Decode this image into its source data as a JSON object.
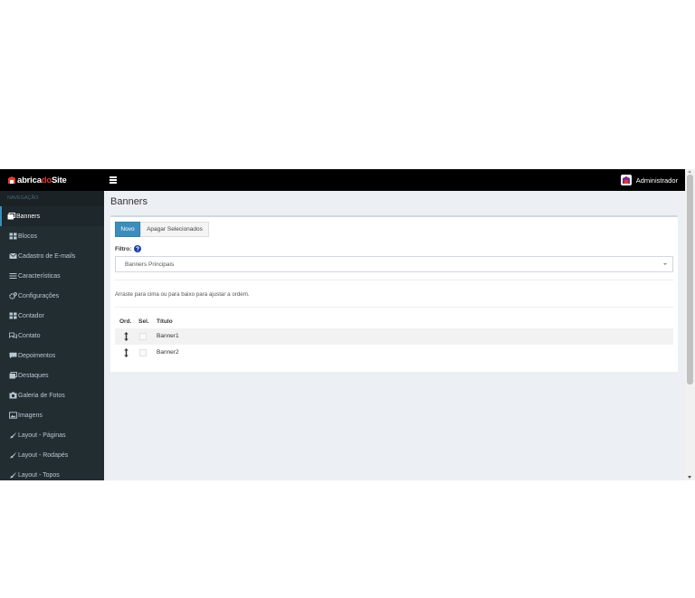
{
  "brand": {
    "part1": "abrica",
    "part2": "do",
    "part3": "Site"
  },
  "header": {
    "user_name": "Administrador"
  },
  "sidebar": {
    "header": "NAVEGAÇÃO",
    "items": [
      {
        "label": "Banners",
        "icon": "images-icon"
      },
      {
        "label": "Blocos",
        "icon": "th-large-icon"
      },
      {
        "label": "Cadastro de E-mails",
        "icon": "envelope-icon"
      },
      {
        "label": "Características",
        "icon": "list-icon"
      },
      {
        "label": "Configurações",
        "icon": "cogs-icon"
      },
      {
        "label": "Contador",
        "icon": "th-large-icon"
      },
      {
        "label": "Contato",
        "icon": "comments-icon"
      },
      {
        "label": "Depoimentos",
        "icon": "comment-icon"
      },
      {
        "label": "Destaques",
        "icon": "images-icon"
      },
      {
        "label": "Galeria de Fotos",
        "icon": "camera-icon"
      },
      {
        "label": "Imagens",
        "icon": "image-icon"
      },
      {
        "label": "Layout - Páginas",
        "icon": "brush-icon"
      },
      {
        "label": "Layout - Rodapés",
        "icon": "brush-icon"
      },
      {
        "label": "Layout - Topos",
        "icon": "brush-icon"
      }
    ]
  },
  "main": {
    "title": "Banners",
    "buttons": {
      "new": "Novo",
      "delete_selected": "Apagar Selecionados"
    },
    "filter": {
      "label": "Filtro:",
      "selected": "Banners Principais"
    },
    "hint": "Arraste para cima ou para baixo para ajustar a ordem.",
    "table": {
      "headers": [
        "Ord.",
        "Sel.",
        "Título"
      ],
      "rows": [
        {
          "title": "Banner1"
        },
        {
          "title": "Banner2"
        }
      ]
    }
  },
  "colors": {
    "accent": "#3c8dbc",
    "sidebar": "#222d32",
    "topbar": "#000000",
    "brand_red": "#e63b2e",
    "background": "#ecf0f5"
  }
}
